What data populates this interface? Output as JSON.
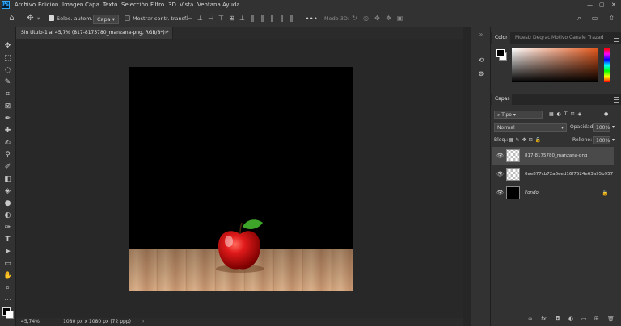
{
  "menu": {
    "logo_text": "Ps",
    "items": [
      "Archivo",
      "Edición",
      "Imagen",
      "Capa",
      "Texto",
      "Selección",
      "Filtro",
      "3D",
      "Vista",
      "Ventana",
      "Ayuda"
    ]
  },
  "options_bar": {
    "auto_select_label": "Selec. autom.:",
    "auto_select_value": "Capa",
    "show_transform_label": "Mostrar contr. transf.",
    "mode_3d_label": "Modo 3D:",
    "more_label": "•••"
  },
  "document": {
    "tab_title": "Sin título-1 al 45,7% (817-8175780_manzana-png, RGB/8*) *",
    "close_glyph": "×"
  },
  "status": {
    "zoom": "45,74%",
    "doc_info": "1080 px x 1080 px (72 ppp)"
  },
  "color_panel": {
    "tabs": [
      "Color",
      "Muestr",
      "Degrac",
      "Motivo",
      "Canale",
      "Trazad"
    ],
    "foreground": "#000000",
    "background": "#ffffff",
    "hue_color": "#e2581d"
  },
  "layers_panel": {
    "tab": "Capas",
    "filter_value": "Tipo",
    "blend_mode": "Normal",
    "opacity_label": "Opacidad:",
    "opacity_value": "100%",
    "lock_label": "Bloq.:",
    "fill_label": "Relleno:",
    "fill_value": "100%",
    "layers": [
      {
        "name": "817-8175780_manzana-png",
        "selected": true
      },
      {
        "name": "0ae877cb72a6eed16f7524e63a95b957",
        "selected": false
      },
      {
        "name": "Fondo",
        "selected": false,
        "locked": true
      }
    ]
  },
  "icons": {
    "home": "home-icon",
    "move": "move-icon",
    "workspace": "workspace-icon",
    "search": "search-icon",
    "share": "share-icon"
  }
}
